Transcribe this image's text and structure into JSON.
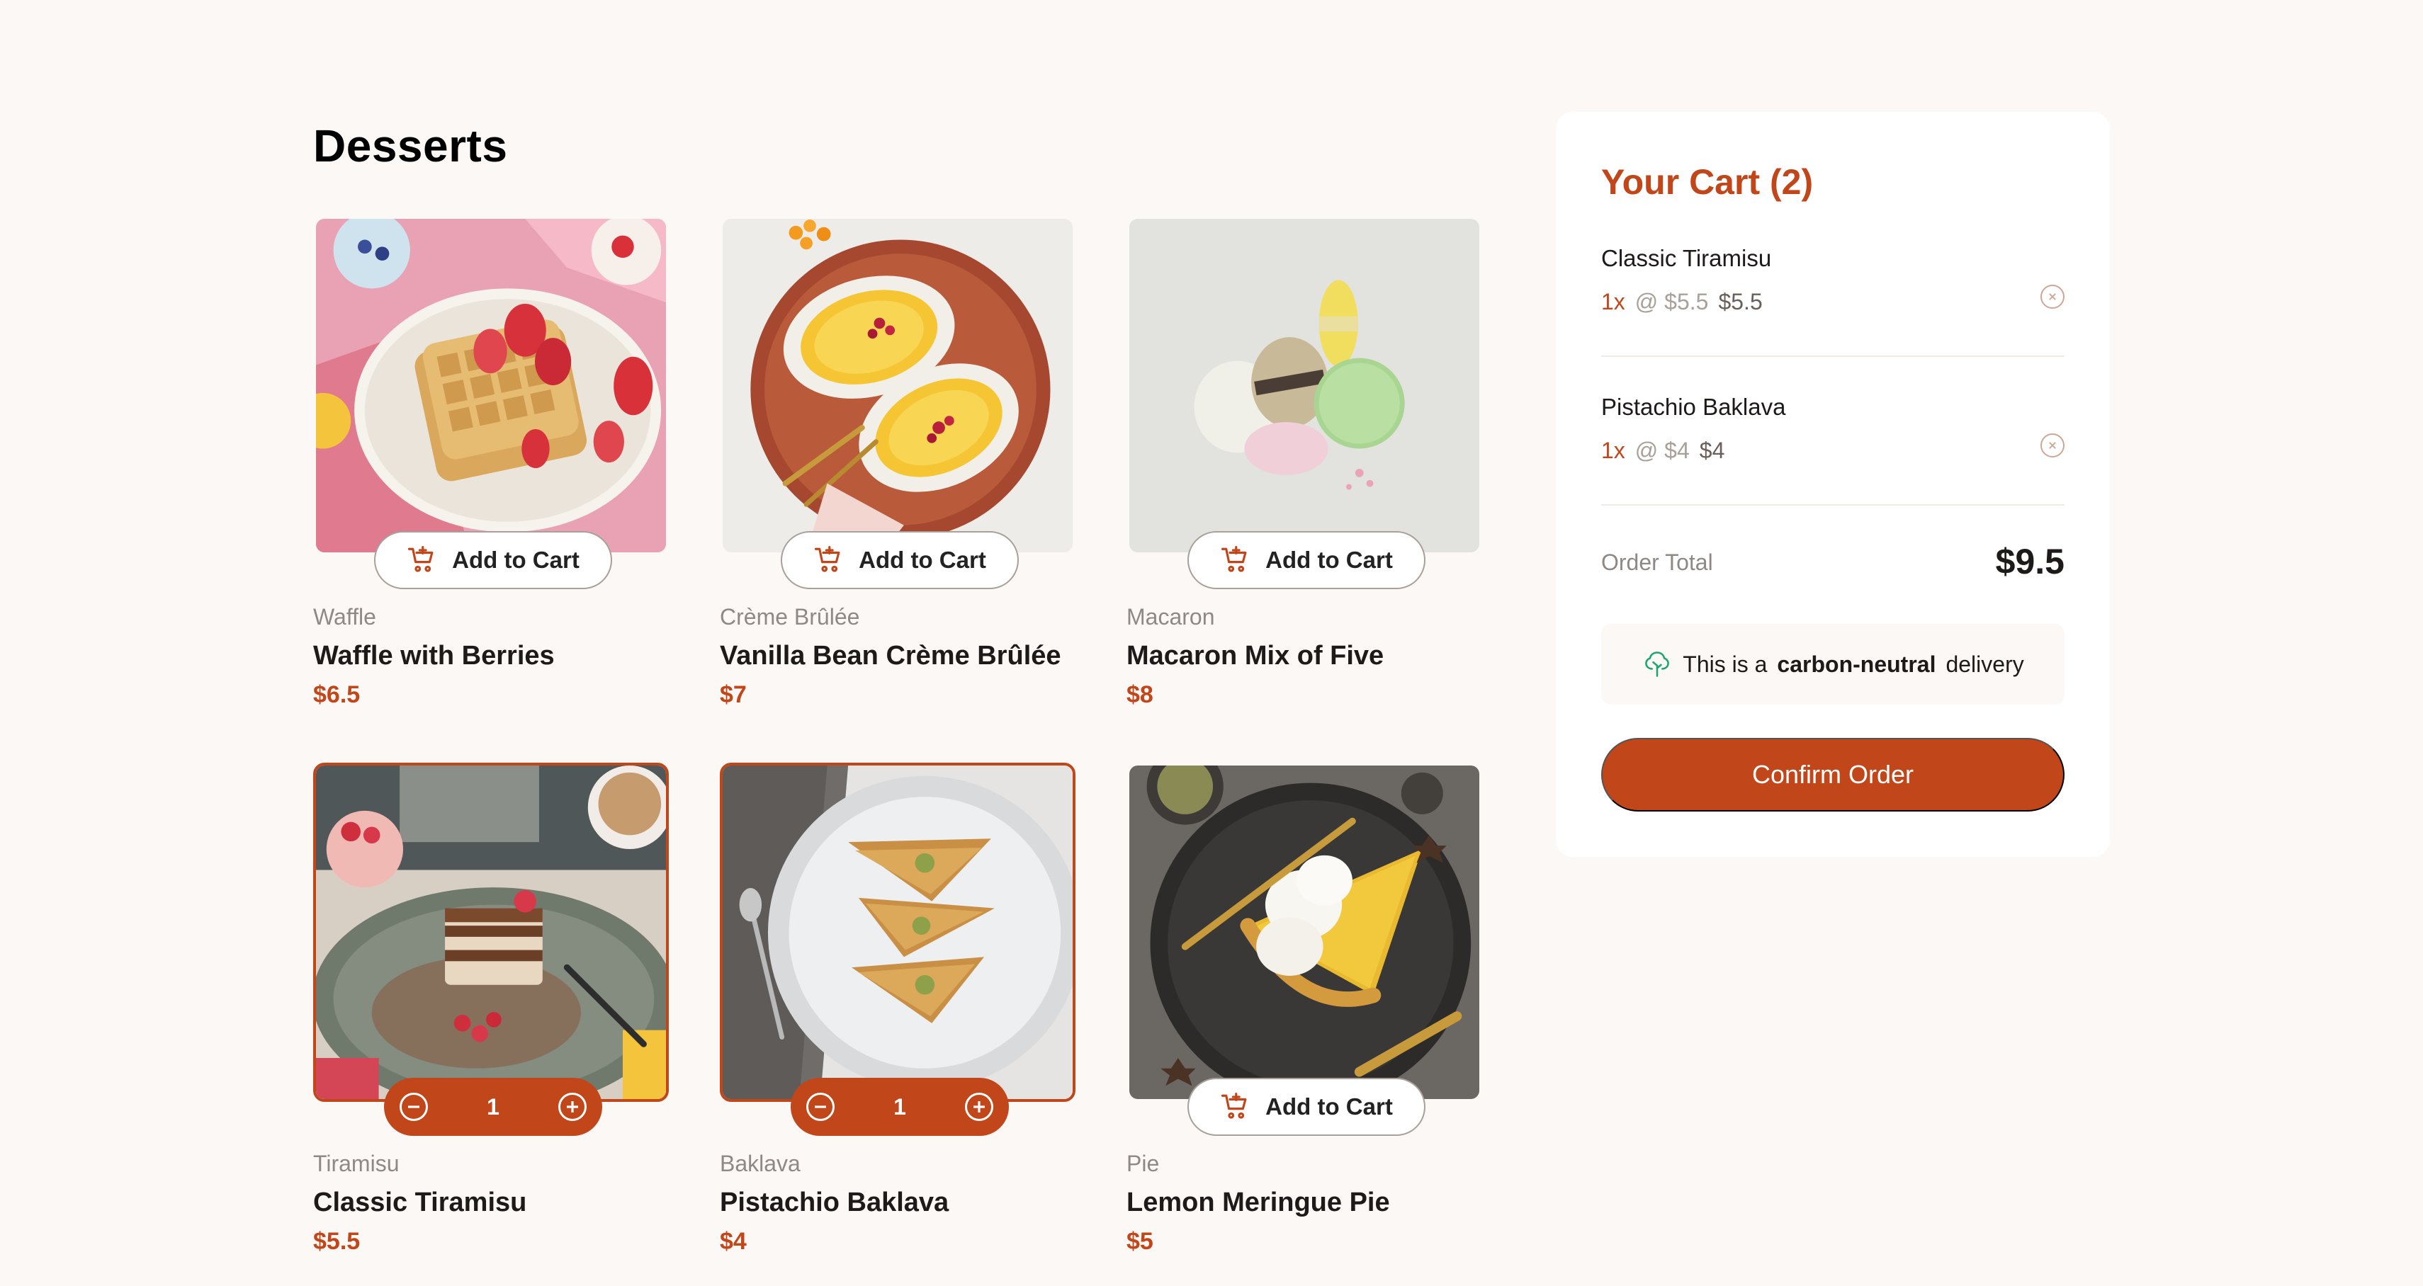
{
  "page_title": "Desserts",
  "add_to_cart_label": "Add to Cart",
  "products": [
    {
      "category": "Waffle",
      "name": "Waffle with Berries",
      "price": "$6.5",
      "in_cart": false,
      "quantity": ""
    },
    {
      "category": "Crème Brûlée",
      "name": "Vanilla Bean Crème Brûlée",
      "price": "$7",
      "in_cart": false,
      "quantity": ""
    },
    {
      "category": "Macaron",
      "name": "Macaron Mix of Five",
      "price": "$8",
      "in_cart": false,
      "quantity": ""
    },
    {
      "category": "Tiramisu",
      "name": "Classic Tiramisu",
      "price": "$5.5",
      "in_cart": true,
      "quantity": "1"
    },
    {
      "category": "Baklava",
      "name": "Pistachio Baklava",
      "price": "$4",
      "in_cart": true,
      "quantity": "1"
    },
    {
      "category": "Pie",
      "name": "Lemon Meringue Pie",
      "price": "$5",
      "in_cart": false,
      "quantity": ""
    }
  ],
  "cart": {
    "title": "Your Cart (2)",
    "items": [
      {
        "name": "Classic Tiramisu",
        "qty": "1x",
        "unit": "@ $5.5",
        "total": "$5.5"
      },
      {
        "name": "Pistachio Baklava",
        "qty": "1x",
        "unit": "@ $4",
        "total": "$4"
      }
    ],
    "order_total_label": "Order Total",
    "order_total": "$9.5",
    "carbon_prefix": "This is a",
    "carbon_bold": "carbon-neutral",
    "carbon_suffix": "delivery",
    "confirm_label": "Confirm Order"
  },
  "colors": {
    "accent": "#c1461a",
    "background": "#fcf8f6",
    "muted_text": "#8f8986"
  }
}
